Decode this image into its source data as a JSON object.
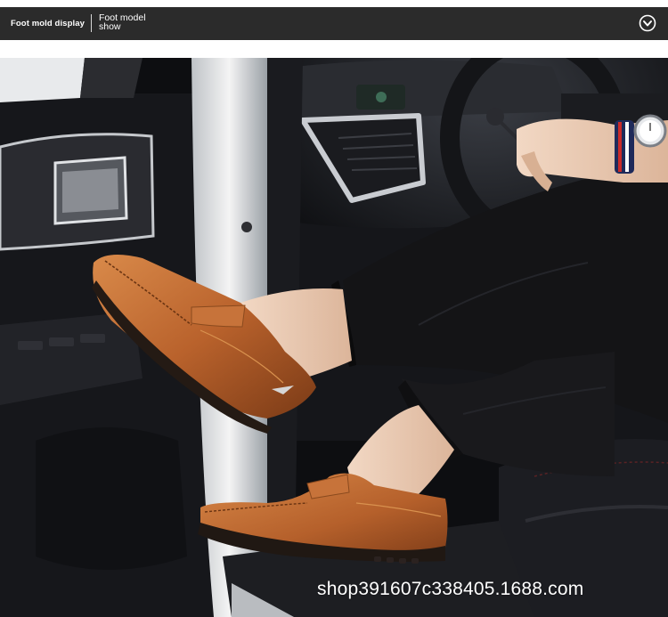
{
  "header": {
    "title": "Foot mold display",
    "subtitle_line1": "Foot model",
    "subtitle_line2": "show",
    "toggle_icon": "chevron-down-circle-icon"
  },
  "photo": {
    "watermark": "shop391607c338405.1688.com"
  },
  "colors": {
    "header_bg": "#2b2b2b",
    "shoe_leather": "#b9622c",
    "trousers": "#141416"
  }
}
